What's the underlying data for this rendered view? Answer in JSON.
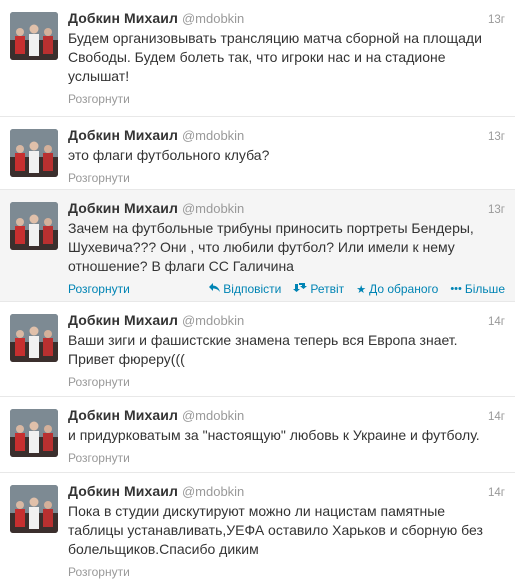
{
  "tweets": [
    {
      "fullname": "Добкин Михаил",
      "username": "@mdobkin",
      "time": "13г",
      "text": "Будем организовывать трансляцию матча  сборной на площади Свободы. Будем болеть так, что игроки нас и на стадионе услышат!",
      "expand": "Розгорнути"
    },
    {
      "fullname": "Добкин Михаил",
      "username": "@mdobkin",
      "time": "13г",
      "text": "это флаги футбольного клуба?",
      "expand": "Розгорнути"
    },
    {
      "fullname": "Добкин Михаил",
      "username": "@mdobkin",
      "time": "13г",
      "text": "Зачем на футбольные трибуны приносить портреты Бендеры, Шухевича??? Они , что любили футбол? Или имели к нему отношение? В флаги СС Галичина",
      "expand": "Розгорнути",
      "actions": {
        "reply": "Відповісти",
        "retweet": "Ретвіт",
        "favorite": "До обраного",
        "more": "Більше"
      }
    },
    {
      "fullname": "Добкин Михаил",
      "username": "@mdobkin",
      "time": "14г",
      "text": "Ваши зиги и фашистские знамена теперь вся Европа знает. Привет фюреру(((",
      "expand": "Розгорнути"
    },
    {
      "fullname": "Добкин Михаил",
      "username": "@mdobkin",
      "time": "14г",
      "text": "и придурковатым за \"настоящую\" любовь к Украине и футболу.",
      "expand": "Розгорнути"
    },
    {
      "fullname": "Добкин Михаил",
      "username": "@mdobkin",
      "time": "14г",
      "text": "Пока в студии дискутируют можно ли нацистам памятные таблицы устанавливать,УЕФА оставило Харьков и сборную без болельщиков.Спасибо диким",
      "expand": "Розгорнути"
    }
  ],
  "colors": {
    "link": "#0084b4",
    "muted": "#999999",
    "text": "#333333",
    "hover_bg": "#f5f5f5"
  },
  "icons": {
    "avatar": "group-photo-avatar",
    "reply": "reply-arrow-icon",
    "retweet": "retweet-icon",
    "favorite": "star-icon",
    "more": "ellipsis-icon"
  }
}
